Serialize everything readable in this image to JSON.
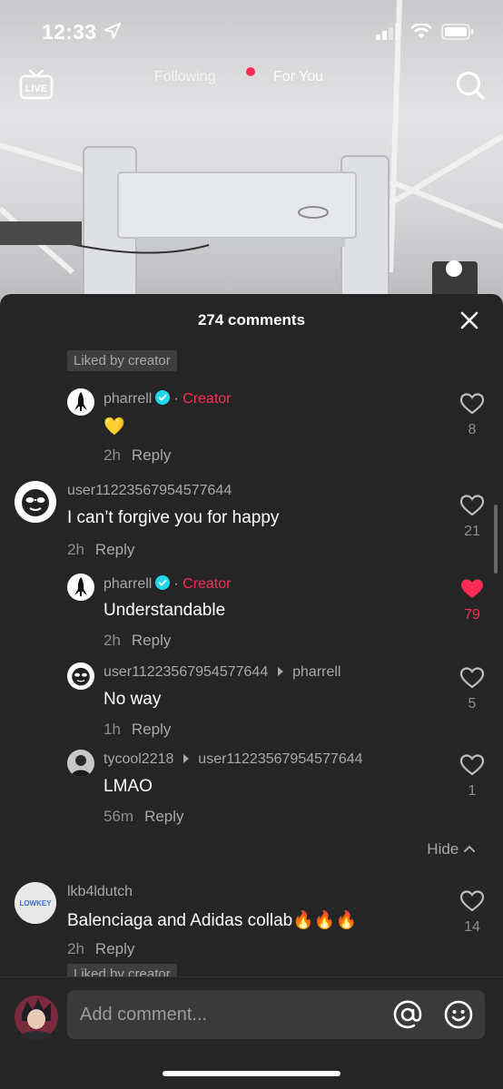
{
  "status": {
    "time": "12:33"
  },
  "nav": {
    "live_label": "LIVE",
    "following": "Following",
    "for_you": "For You"
  },
  "sheet": {
    "title": "274 comments"
  },
  "badges": {
    "liked_by_creator": "Liked by creator"
  },
  "comments": [
    {
      "user": "pharrell",
      "tag": "Creator",
      "text": "💛",
      "time": "2h",
      "reply": "Reply",
      "likes": "8",
      "liked": false
    },
    {
      "user": "user11223567954577644",
      "text": "I can’t forgive you for happy",
      "time": "2h",
      "reply": "Reply",
      "likes": "21",
      "liked": false
    },
    {
      "user": "pharrell",
      "tag": "Creator",
      "text": "Understandable",
      "time": "2h",
      "reply": "Reply",
      "likes": "79",
      "liked": true
    },
    {
      "user": "user11223567954577644",
      "reply_to": "pharrell",
      "text": "No way",
      "time": "1h",
      "reply": "Reply",
      "likes": "5",
      "liked": false
    },
    {
      "user": "tycool2218",
      "reply_to": "user11223567954577644",
      "text": "LMAO",
      "time": "56m",
      "reply": "Reply",
      "likes": "1",
      "liked": false
    },
    {
      "user": "lkb4ldutch",
      "avatar_text": "LOWKEY",
      "text": "Balenciaga and Adidas collab🔥🔥🔥",
      "time": "2h",
      "reply": "Reply",
      "likes": "14",
      "liked": false
    }
  ],
  "hide_label": "Hide",
  "composer": {
    "placeholder": "Add comment..."
  },
  "colors": {
    "accent": "#fe2c55",
    "sheet_bg": "#252525",
    "verified": "#20d5ec"
  }
}
